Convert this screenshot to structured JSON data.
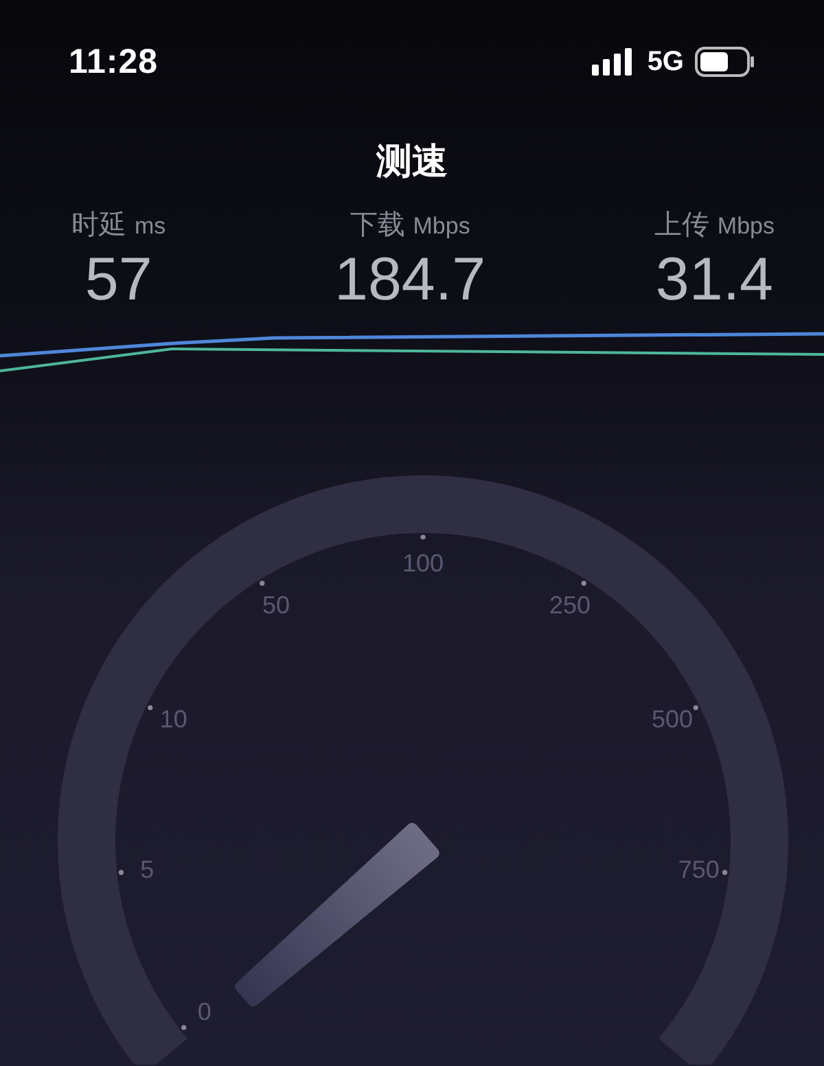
{
  "status_bar": {
    "time": "11:28",
    "network": "5G"
  },
  "title": "测速",
  "metrics": [
    {
      "label": "时延",
      "unit": "ms",
      "value": "57"
    },
    {
      "label": "下载",
      "unit": "Mbps",
      "value": "184.7"
    },
    {
      "label": "上传",
      "unit": "Mbps",
      "value": "31.4"
    }
  ],
  "gauge": {
    "ticks": [
      "0",
      "5",
      "10",
      "50",
      "100",
      "250",
      "500",
      "750"
    ]
  }
}
